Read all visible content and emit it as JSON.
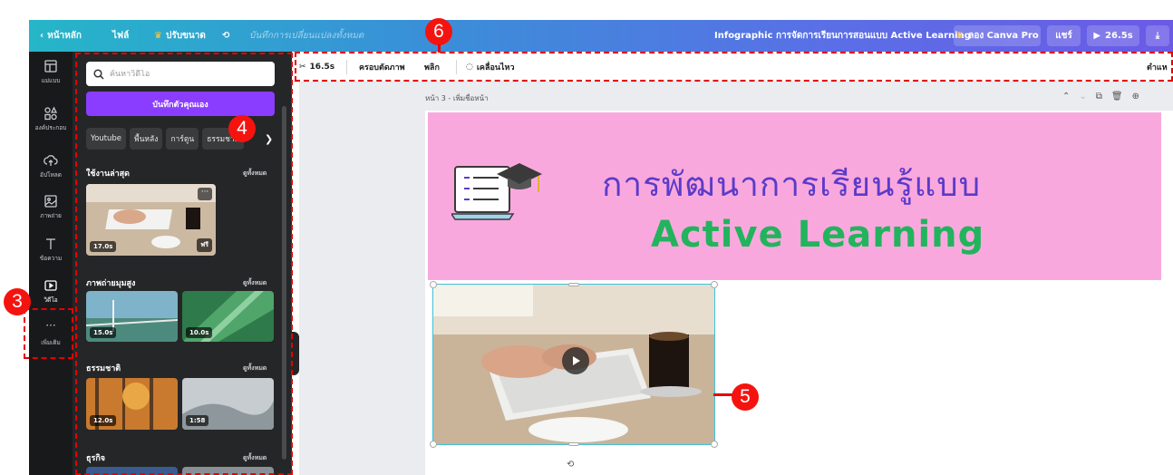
{
  "topbar": {
    "back_label": "หน้าหลัก",
    "file_label": "ไฟล์",
    "resize_label": "ปรับขนาด",
    "saved_status": "บันทึกการเปลี่ยนแปลงทั้งหมด",
    "doc_title": "Infographic การจัดการเรียนการสอนแบบ Active Learning",
    "pro_label": "ลอง Canva Pro",
    "share_label": "แชร์",
    "play_duration": "26.5s"
  },
  "rail": {
    "items": [
      {
        "label": "แม่แบบ",
        "icon": "template-icon"
      },
      {
        "label": "องค์ประกอบ",
        "icon": "elements-icon"
      },
      {
        "label": "อัปโหลด",
        "icon": "upload-icon"
      },
      {
        "label": "ภาพถ่าย",
        "icon": "photo-icon"
      },
      {
        "label": "ข้อความ",
        "icon": "text-icon"
      },
      {
        "label": "วิดีโอ",
        "icon": "video-icon"
      },
      {
        "label": "เพิ่มเติม",
        "icon": "more-icon"
      }
    ]
  },
  "panel": {
    "search_placeholder": "ค้นหาวิดีโอ",
    "record_label": "บันทึกตัวคุณเอง",
    "chips": [
      "Youtube",
      "พื้นหลัง",
      "การ์ตูน",
      "ธรรมชาติ"
    ],
    "see_all": "ดูทั้งหมด",
    "sections": [
      {
        "title": "ใช้งานล่าสุด",
        "videos": [
          {
            "duration": "17.0s",
            "badge": "ฟรี"
          }
        ]
      },
      {
        "title": "ภาพถ่ายมุมสูง",
        "videos": [
          {
            "duration": "15.0s"
          },
          {
            "duration": "10.0s"
          }
        ]
      },
      {
        "title": "ธรรมชาติ",
        "videos": [
          {
            "duration": "12.0s"
          },
          {
            "duration": "1:58"
          }
        ]
      },
      {
        "title": "ธุรกิจ",
        "videos": []
      }
    ]
  },
  "toolbar": {
    "duration": "16.5s",
    "crop_label": "ครอบตัดภาพ",
    "flip_label": "พลิก",
    "animate_label": "เคลื่อนไหว",
    "position_label": "ตำแห"
  },
  "canvas": {
    "page_label": "หน้า 3 - เพิ่มชื่อหน้า",
    "title_th": "การพัฒนาการเรียนรู้แบบ",
    "title_en": "Active Learning"
  },
  "annotations": {
    "badge_3": "3",
    "badge_4": "4",
    "badge_5": "5",
    "badge_6": "6"
  },
  "colors": {
    "accent_purple": "#8b3dff",
    "banner_pink": "#f9a8de",
    "title_purple": "#5b3bc8",
    "title_green": "#22b45c",
    "annotation_red": "#e60000"
  }
}
